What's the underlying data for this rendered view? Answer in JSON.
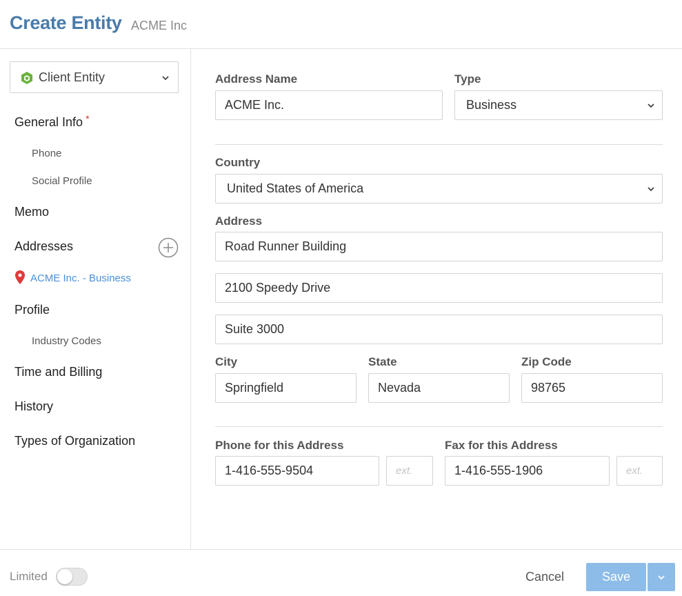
{
  "header": {
    "title": "Create Entity",
    "subtitle": "ACME Inc"
  },
  "sidebar": {
    "entity_type": "Client Entity",
    "nav": {
      "general_info": "General Info",
      "required_marker": "*",
      "phone": "Phone",
      "social_profile": "Social Profile",
      "memo": "Memo",
      "addresses": "Addresses",
      "address_item": "ACME Inc. - Business",
      "profile": "Profile",
      "industry_codes": "Industry Codes",
      "time_billing": "Time and Billing",
      "history": "History",
      "types_org": "Types of Organization"
    }
  },
  "form": {
    "address_name": {
      "label": "Address Name",
      "value": "ACME Inc."
    },
    "type": {
      "label": "Type",
      "value": "Business"
    },
    "country": {
      "label": "Country",
      "value": "United States of America"
    },
    "address": {
      "label": "Address",
      "line1": "Road Runner Building",
      "line2": "2100 Speedy Drive",
      "line3": "Suite 3000"
    },
    "city": {
      "label": "City",
      "value": "Springfield"
    },
    "state": {
      "label": "State",
      "value": "Nevada"
    },
    "zip": {
      "label": "Zip Code",
      "value": "98765"
    },
    "phone": {
      "label": "Phone for this Address",
      "value": "1-416-555-9504",
      "ext_placeholder": "ext."
    },
    "fax": {
      "label": "Fax for this Address",
      "value": "1-416-555-1906",
      "ext_placeholder": "ext."
    }
  },
  "footer": {
    "limited_label": "Limited",
    "limited_on": false,
    "cancel_label": "Cancel",
    "save_label": "Save"
  },
  "colors": {
    "title": "#4a7ba9",
    "link": "#4a90d9",
    "save_button": "#8dbce8",
    "required": "#d9302c",
    "entity_icon": "#6ab33e"
  }
}
